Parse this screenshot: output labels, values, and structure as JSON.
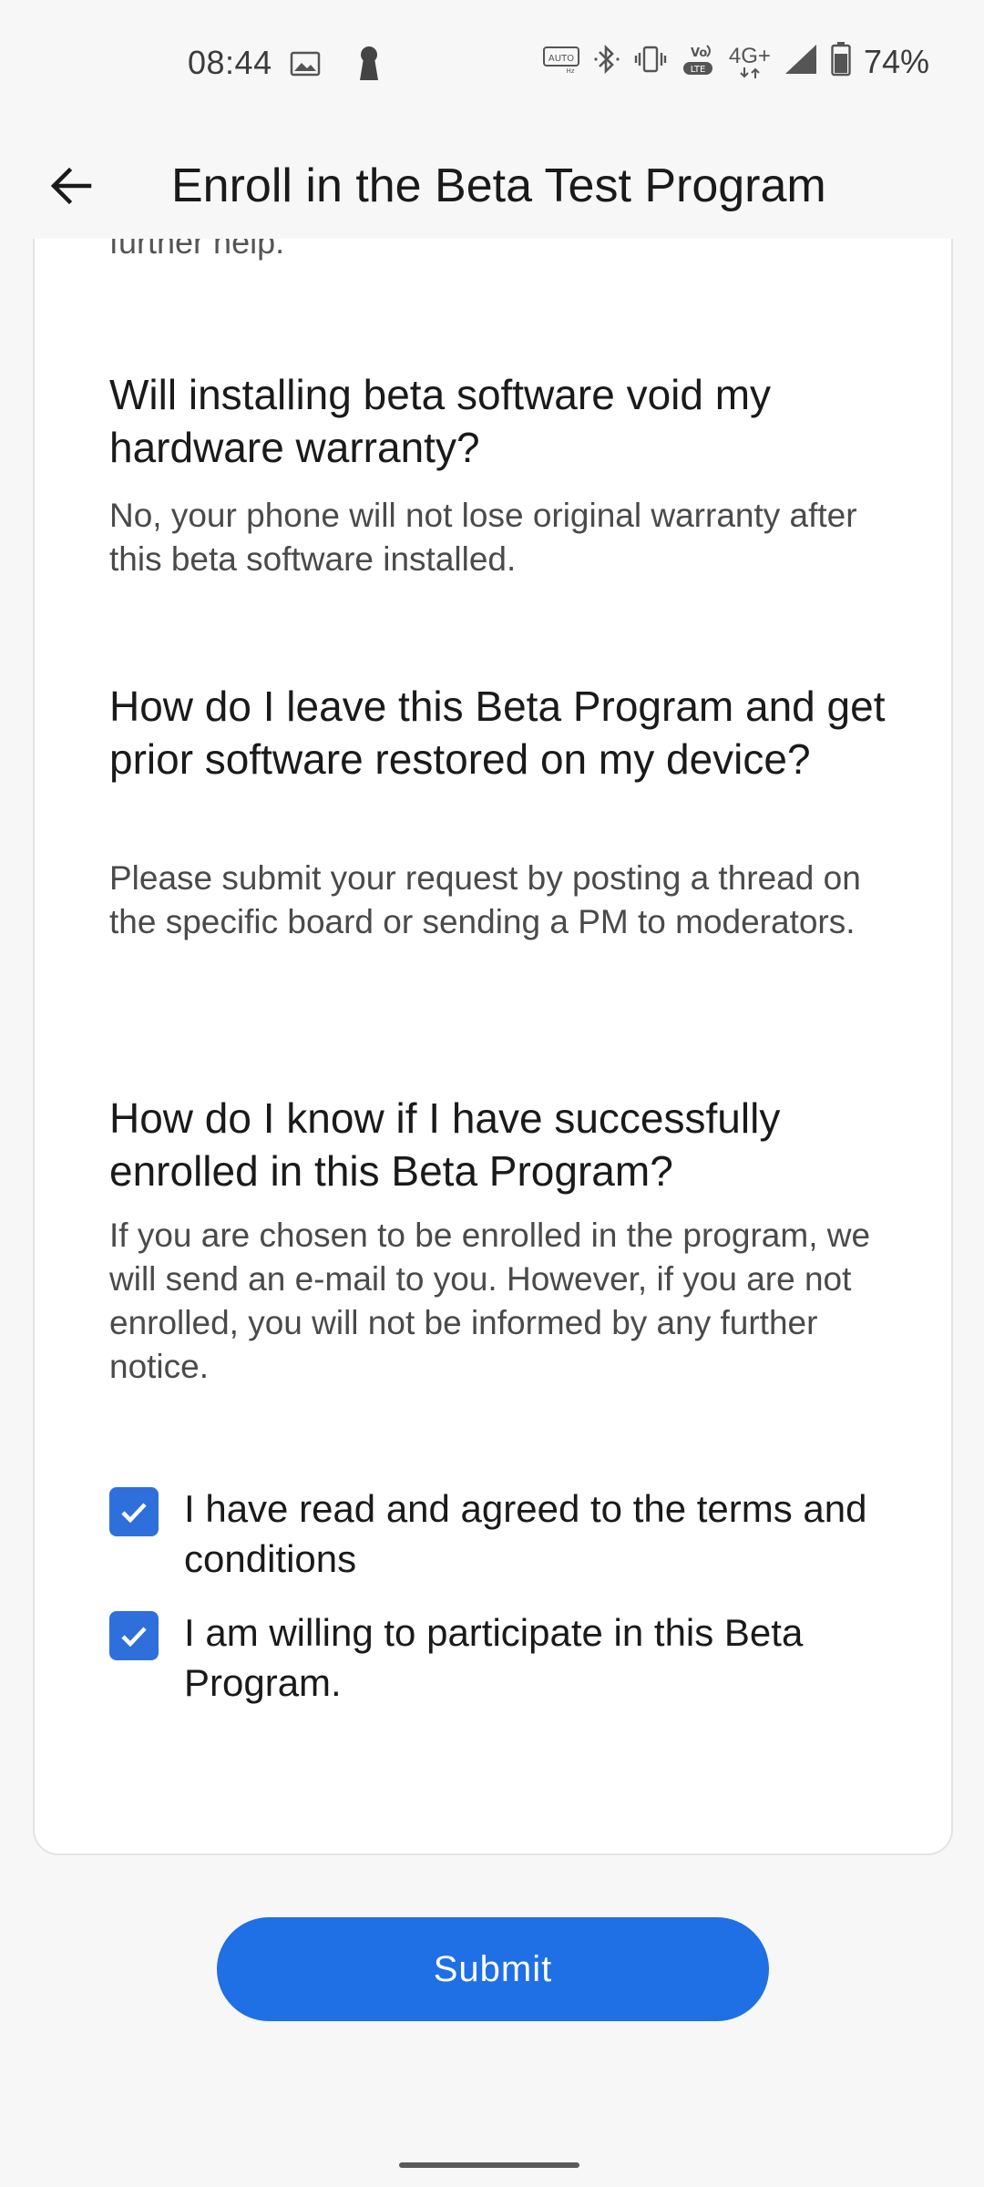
{
  "status": {
    "time": "08:44",
    "battery": "74%",
    "network": "4G+",
    "icons": [
      "gallery-icon",
      "keyhole-icon",
      "auto-hz-icon",
      "bluetooth-icon",
      "vibrate-icon",
      "volte-icon",
      "network-4g-icon",
      "signal-icon",
      "battery-icon"
    ]
  },
  "app_bar": {
    "title": "Enroll in the Beta Test Program"
  },
  "content": {
    "clipped_text": "further help.",
    "faqs": [
      {
        "question": "Will installing beta software void my hardware warranty?",
        "answer": "No, your phone will not lose original warranty after this beta software installed."
      },
      {
        "question": "How do I leave this Beta Program and get prior software restored on my device?",
        "answer": "Please submit your request by posting a thread on the specific board or sending a PM to moderators."
      },
      {
        "question": "How do I know if I have successfully enrolled in this Beta Program?",
        "answer": "If you are chosen to be enrolled in the program, we will send an e-mail to you. However, if you are not enrolled, you will not be informed by any further notice."
      }
    ],
    "checkboxes": [
      {
        "label": "I have read and agreed to the terms and conditions",
        "checked": true
      },
      {
        "label": "I am willing to participate in this Beta Program.",
        "checked": true
      }
    ]
  },
  "submit": {
    "label": "Submit"
  },
  "colors": {
    "accent": "#1f6fe5",
    "checkbox": "#2e6fdc",
    "background": "#f7f7f7",
    "card": "#ffffff"
  }
}
